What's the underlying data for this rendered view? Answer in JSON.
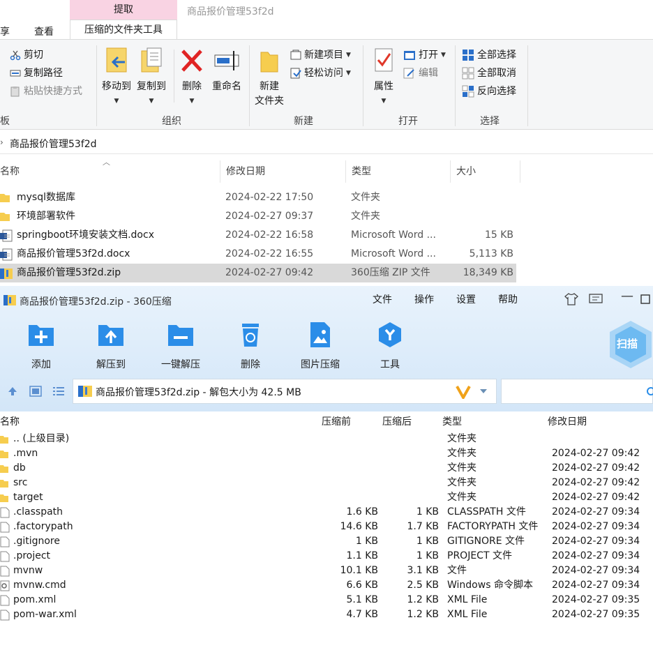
{
  "explorer": {
    "tabs": {
      "share_partial": "享",
      "view": "查看",
      "context_tab": "压缩的文件夹工具",
      "extract_tab": "提取"
    },
    "window_title": "商品报价管理53f2d",
    "ribbon": {
      "clipboard": {
        "cut": "剪切",
        "copy_path": "复制路径",
        "paste_shortcut": "粘贴快捷方式",
        "group_partial": "板"
      },
      "organize": {
        "move_to": "移动到",
        "copy_to": "复制到",
        "delete": "删除",
        "rename": "重命名",
        "group": "组织"
      },
      "new": {
        "new_folder_line1": "新建",
        "new_folder_line2": "文件夹",
        "new_item": "新建项目",
        "easy_access": "轻松访问",
        "group": "新建"
      },
      "open": {
        "properties": "属性",
        "open": "打开",
        "edit": "编辑",
        "group": "打开"
      },
      "select": {
        "select_all": "全部选择",
        "select_none": "全部取消",
        "invert": "反向选择",
        "group": "选择"
      }
    },
    "address": "商品报价管理53f2d",
    "columns": {
      "name": "名称",
      "modified": "修改日期",
      "type": "类型",
      "size": "大小"
    },
    "files": [
      {
        "name": "mysql数据库",
        "modified": "2024-02-22 17:50",
        "type": "文件夹",
        "size": "",
        "icon": "folder-icon"
      },
      {
        "name": "环境部署软件",
        "modified": "2024-02-27 09:37",
        "type": "文件夹",
        "size": "",
        "icon": "folder-icon"
      },
      {
        "name": "springboot环境安装文档.docx",
        "modified": "2024-02-22 16:58",
        "type": "Microsoft Word ...",
        "size": "15 KB",
        "icon": "word-doc-icon"
      },
      {
        "name": "商品报价管理53f2d.docx",
        "modified": "2024-02-22 16:55",
        "type": "Microsoft Word ...",
        "size": "5,113 KB",
        "icon": "word-doc-icon"
      },
      {
        "name": "商品报价管理53f2d.zip",
        "modified": "2024-02-27 09:42",
        "type": "360压缩 ZIP 文件",
        "size": "18,349 KB",
        "icon": "zip-icon"
      }
    ]
  },
  "zip360": {
    "title": "商品报价管理53f2d.zip - 360压缩",
    "menu": [
      "文件",
      "操作",
      "设置",
      "帮助"
    ],
    "toolbar": [
      "添加",
      "解压到",
      "一键解压",
      "删除",
      "图片压缩",
      "工具"
    ],
    "scan": "扫描",
    "path": "商品报价管理53f2d.zip - 解包大小为 42.5 MB",
    "columns": {
      "name": "名称",
      "orig": "压缩前",
      "comp": "压缩后",
      "type": "类型",
      "modified": "修改日期"
    },
    "rows": [
      {
        "name": ".. (上级目录)",
        "orig": "",
        "comp": "",
        "type": "文件夹",
        "modified": "",
        "icon": "folder"
      },
      {
        "name": ".mvn",
        "orig": "",
        "comp": "",
        "type": "文件夹",
        "modified": "2024-02-27 09:42",
        "icon": "folder"
      },
      {
        "name": "db",
        "orig": "",
        "comp": "",
        "type": "文件夹",
        "modified": "2024-02-27 09:42",
        "icon": "folder"
      },
      {
        "name": "src",
        "orig": "",
        "comp": "",
        "type": "文件夹",
        "modified": "2024-02-27 09:42",
        "icon": "folder"
      },
      {
        "name": "target",
        "orig": "",
        "comp": "",
        "type": "文件夹",
        "modified": "2024-02-27 09:42",
        "icon": "folder"
      },
      {
        "name": ".classpath",
        "orig": "1.6 KB",
        "comp": "1 KB",
        "type": "CLASSPATH 文件",
        "modified": "2024-02-27 09:34",
        "icon": "file"
      },
      {
        "name": ".factorypath",
        "orig": "14.6 KB",
        "comp": "1.7 KB",
        "type": "FACTORYPATH 文件",
        "modified": "2024-02-27 09:34",
        "icon": "file"
      },
      {
        "name": ".gitignore",
        "orig": "1 KB",
        "comp": "1 KB",
        "type": "GITIGNORE 文件",
        "modified": "2024-02-27 09:34",
        "icon": "file"
      },
      {
        "name": ".project",
        "orig": "1.1 KB",
        "comp": "1 KB",
        "type": "PROJECT 文件",
        "modified": "2024-02-27 09:34",
        "icon": "file"
      },
      {
        "name": "mvnw",
        "orig": "10.1 KB",
        "comp": "3.1 KB",
        "type": "文件",
        "modified": "2024-02-27 09:34",
        "icon": "file"
      },
      {
        "name": "mvnw.cmd",
        "orig": "6.6 KB",
        "comp": "2.5 KB",
        "type": "Windows 命令脚本",
        "modified": "2024-02-27 09:34",
        "icon": "gear-file"
      },
      {
        "name": "pom.xml",
        "orig": "5.1 KB",
        "comp": "1.2 KB",
        "type": "XML File",
        "modified": "2024-02-27 09:35",
        "icon": "file"
      },
      {
        "name": "pom-war.xml",
        "orig": "4.7 KB",
        "comp": "1.2 KB",
        "type": "XML File",
        "modified": "2024-02-27 09:35",
        "icon": "file"
      }
    ]
  }
}
